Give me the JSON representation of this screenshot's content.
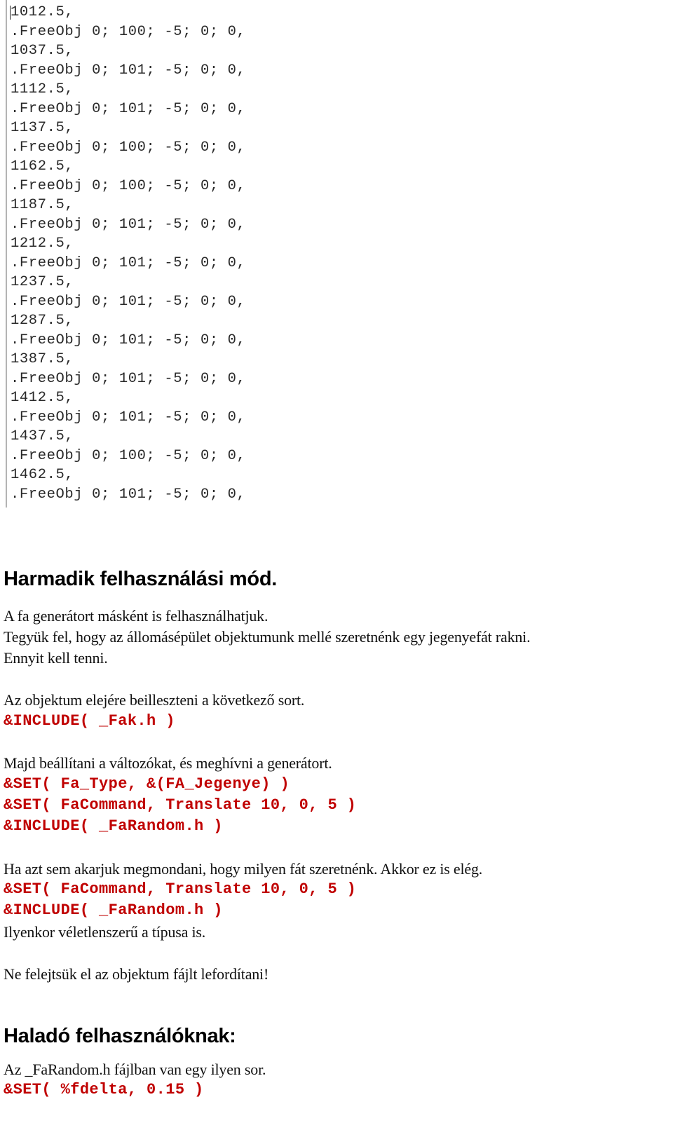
{
  "code_screenshot": {
    "lines": [
      "1012.5,",
      ".FreeObj 0; 100; -5; 0; 0,",
      "1037.5,",
      ".FreeObj 0; 101; -5; 0; 0,",
      "1112.5,",
      ".FreeObj 0; 101; -5; 0; 0,",
      "1137.5,",
      ".FreeObj 0; 100; -5; 0; 0,",
      "1162.5,",
      ".FreeObj 0; 100; -5; 0; 0,",
      "1187.5,",
      ".FreeObj 0; 101; -5; 0; 0,",
      "1212.5,",
      ".FreeObj 0; 101; -5; 0; 0,",
      "1237.5,",
      ".FreeObj 0; 101; -5; 0; 0,",
      "1287.5,",
      ".FreeObj 0; 101; -5; 0; 0,",
      "1387.5,",
      ".FreeObj 0; 101; -5; 0; 0,",
      "1412.5,",
      ".FreeObj 0; 101; -5; 0; 0,",
      "1437.5,",
      ".FreeObj 0; 100; -5; 0; 0,",
      "1462.5,",
      ".FreeObj 0; 101; -5; 0; 0,"
    ]
  },
  "section_third": {
    "heading": "Harmadik felhasználási mód.",
    "intro_1": "A fa generátort másként is felhasználhatjuk.",
    "intro_2": "Tegyük fel, hogy az állomásépület objektumunk mellé szeretnénk egy jegenyefát rakni.",
    "intro_3": "Ennyit kell tenni.",
    "step1_text": "Az objektum elejére beilleszteni a következő sort.",
    "step1_code": "&INCLUDE( _Fak.h )",
    "step2_text": "Majd beállítani a változókat, és meghívni a generátort.",
    "step2_code_1": "&SET( Fa_Type, &(FA_Jegenye) )",
    "step2_code_2": "&SET( FaCommand, Translate 10, 0, 5 )",
    "step2_code_3": "&INCLUDE( _FaRandom.h )",
    "step3_text": "Ha azt sem akarjuk megmondani, hogy milyen fát szeretnénk. Akkor ez is elég.",
    "step3_code_1": "&SET( FaCommand, Translate 10, 0, 5 )",
    "step3_code_2": "&INCLUDE( _FaRandom.h )",
    "step3_note": "Ilyenkor véletlenszerű a típusa is.",
    "reminder": "Ne felejtsük el az objektum fájlt lefordítani!"
  },
  "section_advanced": {
    "heading": "Haladó felhasználóknak:",
    "text": "Az _FaRandom.h fájlban van egy ilyen sor.",
    "code": "&SET( %fdelta, 0.15 )"
  },
  "colors": {
    "code_red": "#c00000",
    "text": "#000000"
  }
}
